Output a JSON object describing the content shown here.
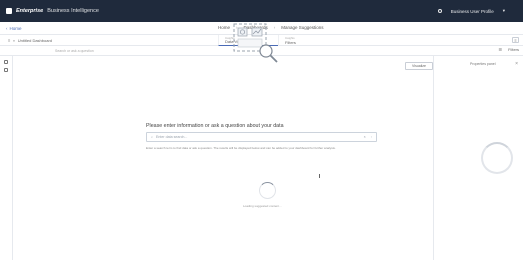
{
  "topbar": {
    "brand_primary": "Enterprise",
    "brand_secondary": "Business Intelligence",
    "user_label": "Business User Profile"
  },
  "nav": {
    "back_label": "Home",
    "breadcrumbs": [
      "Home",
      "Dashboards",
      "Manage Suggestions"
    ]
  },
  "tabs": {
    "file_label": "Untitled Dashboard",
    "center": [
      {
        "small": "Insights",
        "label": "Data Visualization"
      },
      {
        "small": "Insights",
        "label": "Filters"
      }
    ],
    "right_btn": "≡"
  },
  "toolbar": {
    "hint": "Search or ask a question",
    "right_a": "☰",
    "right_b": "Filters"
  },
  "canvas": {
    "button_label": "Visualize",
    "prompt_title": "Please enter information or ask a question about your data",
    "search_placeholder": "Enter data search...",
    "note": "Enter a search term to find data or ask a question. The results will be displayed below and can be added to your dashboard for further analysis.",
    "loading_label": "Loading suggested content..."
  },
  "right_panel": {
    "title": "Properties panel"
  }
}
